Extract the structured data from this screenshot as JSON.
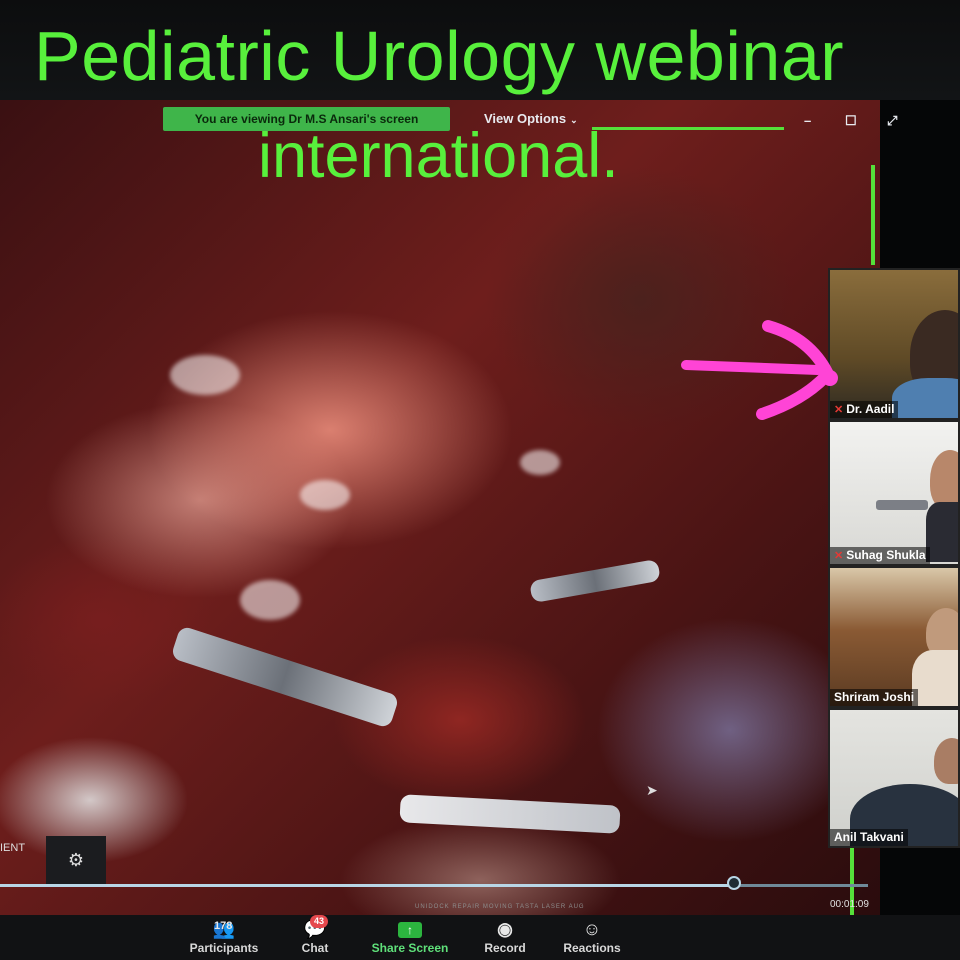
{
  "overlay": {
    "title_line1": "Pediatric Urology webinar",
    "title_line2": "international."
  },
  "zoom_top": {
    "viewing_banner": "You are viewing Dr M.S Ansari's screen",
    "view_options": "View Options",
    "view_options_caret": "⌄",
    "minimize": "–",
    "maximize": "☐",
    "fullscreen": "⤢"
  },
  "participants_gallery": [
    {
      "name": "Dr. Aadil",
      "muted": true
    },
    {
      "name": "Suhag Shukla",
      "muted": true
    },
    {
      "name": "Shriram Joshi",
      "muted": false
    },
    {
      "name": "Anil Takvani",
      "muted": false
    }
  ],
  "video": {
    "pip_label": "IENT",
    "progress": 0.846,
    "timecode": "00:01:09",
    "ticker": "UNIDOCK REPAIR MOVING TASTA  LASER AUG"
  },
  "toolbar": {
    "participants_label": "Participants",
    "participants_count": "178",
    "chat_label": "Chat",
    "chat_badge": "43",
    "share_label": "Share Screen",
    "record_label": "Record",
    "reactions_label": "Reactions"
  },
  "colors": {
    "overlay_text": "#58f03c",
    "annotation_arrow": "#ff44d6",
    "share_green": "#2cb53f",
    "muted_red": "#e53935"
  }
}
